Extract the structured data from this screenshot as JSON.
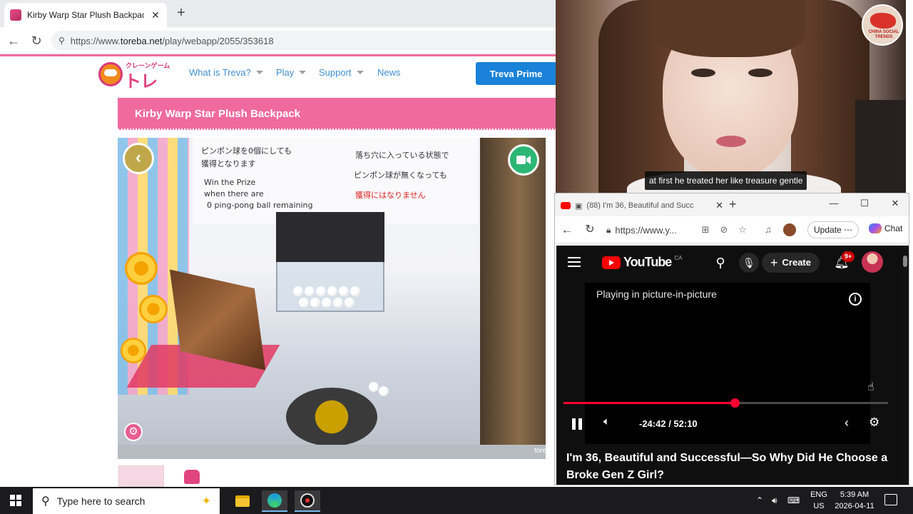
{
  "main_browser": {
    "tab_title": "Kirby Warp Star Plush Backpack | C",
    "new_tab": "+",
    "url_prefix": "https://www.",
    "url_host": "toreba.net",
    "url_path": "/play/webapp/2055/353618"
  },
  "site": {
    "logo_small": "クレーンゲーム",
    "logo_big": "トレバ",
    "nav": [
      {
        "label": "What is Treva?",
        "has_dropdown": true
      },
      {
        "label": "Play",
        "has_dropdown": true
      },
      {
        "label": "Support",
        "has_dropdown": true
      },
      {
        "label": "News",
        "has_dropdown": false
      }
    ],
    "prime_button": "Treva Prime",
    "product_title": "Kirby Warp Star Plush Backpack",
    "game_sign": {
      "line1": "ピンポン球を0個にしても",
      "line2": "獲得となります",
      "line3": "Win the Prize",
      "line4": "when there are",
      "line5": "0 ping-pong ball remaining",
      "line6": "落ち穴に入っている状態で",
      "line7": "ピンポン球が無くなっても",
      "line8": "獲得にはなりません"
    },
    "watermark": "tore"
  },
  "webcam": {
    "caption": "at first he treated her like treasure gentle",
    "badge_text": "CHINA SOCIAL TRENDS"
  },
  "yt_browser": {
    "tab_title": "(88) I'm 36, Beautiful and Succ",
    "url": "https://www.y...",
    "update_label": "Update",
    "chat_label": "Chat",
    "win_minimize": "—",
    "win_maximize": "☐",
    "win_close": "✕"
  },
  "youtube": {
    "logo_text": "YouTube",
    "country": "CA",
    "create_label": "Create",
    "notification_count": "9+",
    "pip_text": "Playing in picture-in-picture",
    "time_display": "-24:42 / 52:10",
    "progress_fraction": 0.527,
    "video_title": "I'm 36, Beautiful and Successful—So Why Did He Choose a Broke Gen Z Girl?"
  },
  "taskbar": {
    "search_placeholder": "Type here to search",
    "lang_line1": "ENG",
    "lang_line2": "US",
    "time": "5:39 AM",
    "date": "2026-04-11"
  },
  "colors": {
    "treva_pink": "#f06aa0",
    "treva_blue": "#1a82d8",
    "yt_red": "#ff0033"
  }
}
